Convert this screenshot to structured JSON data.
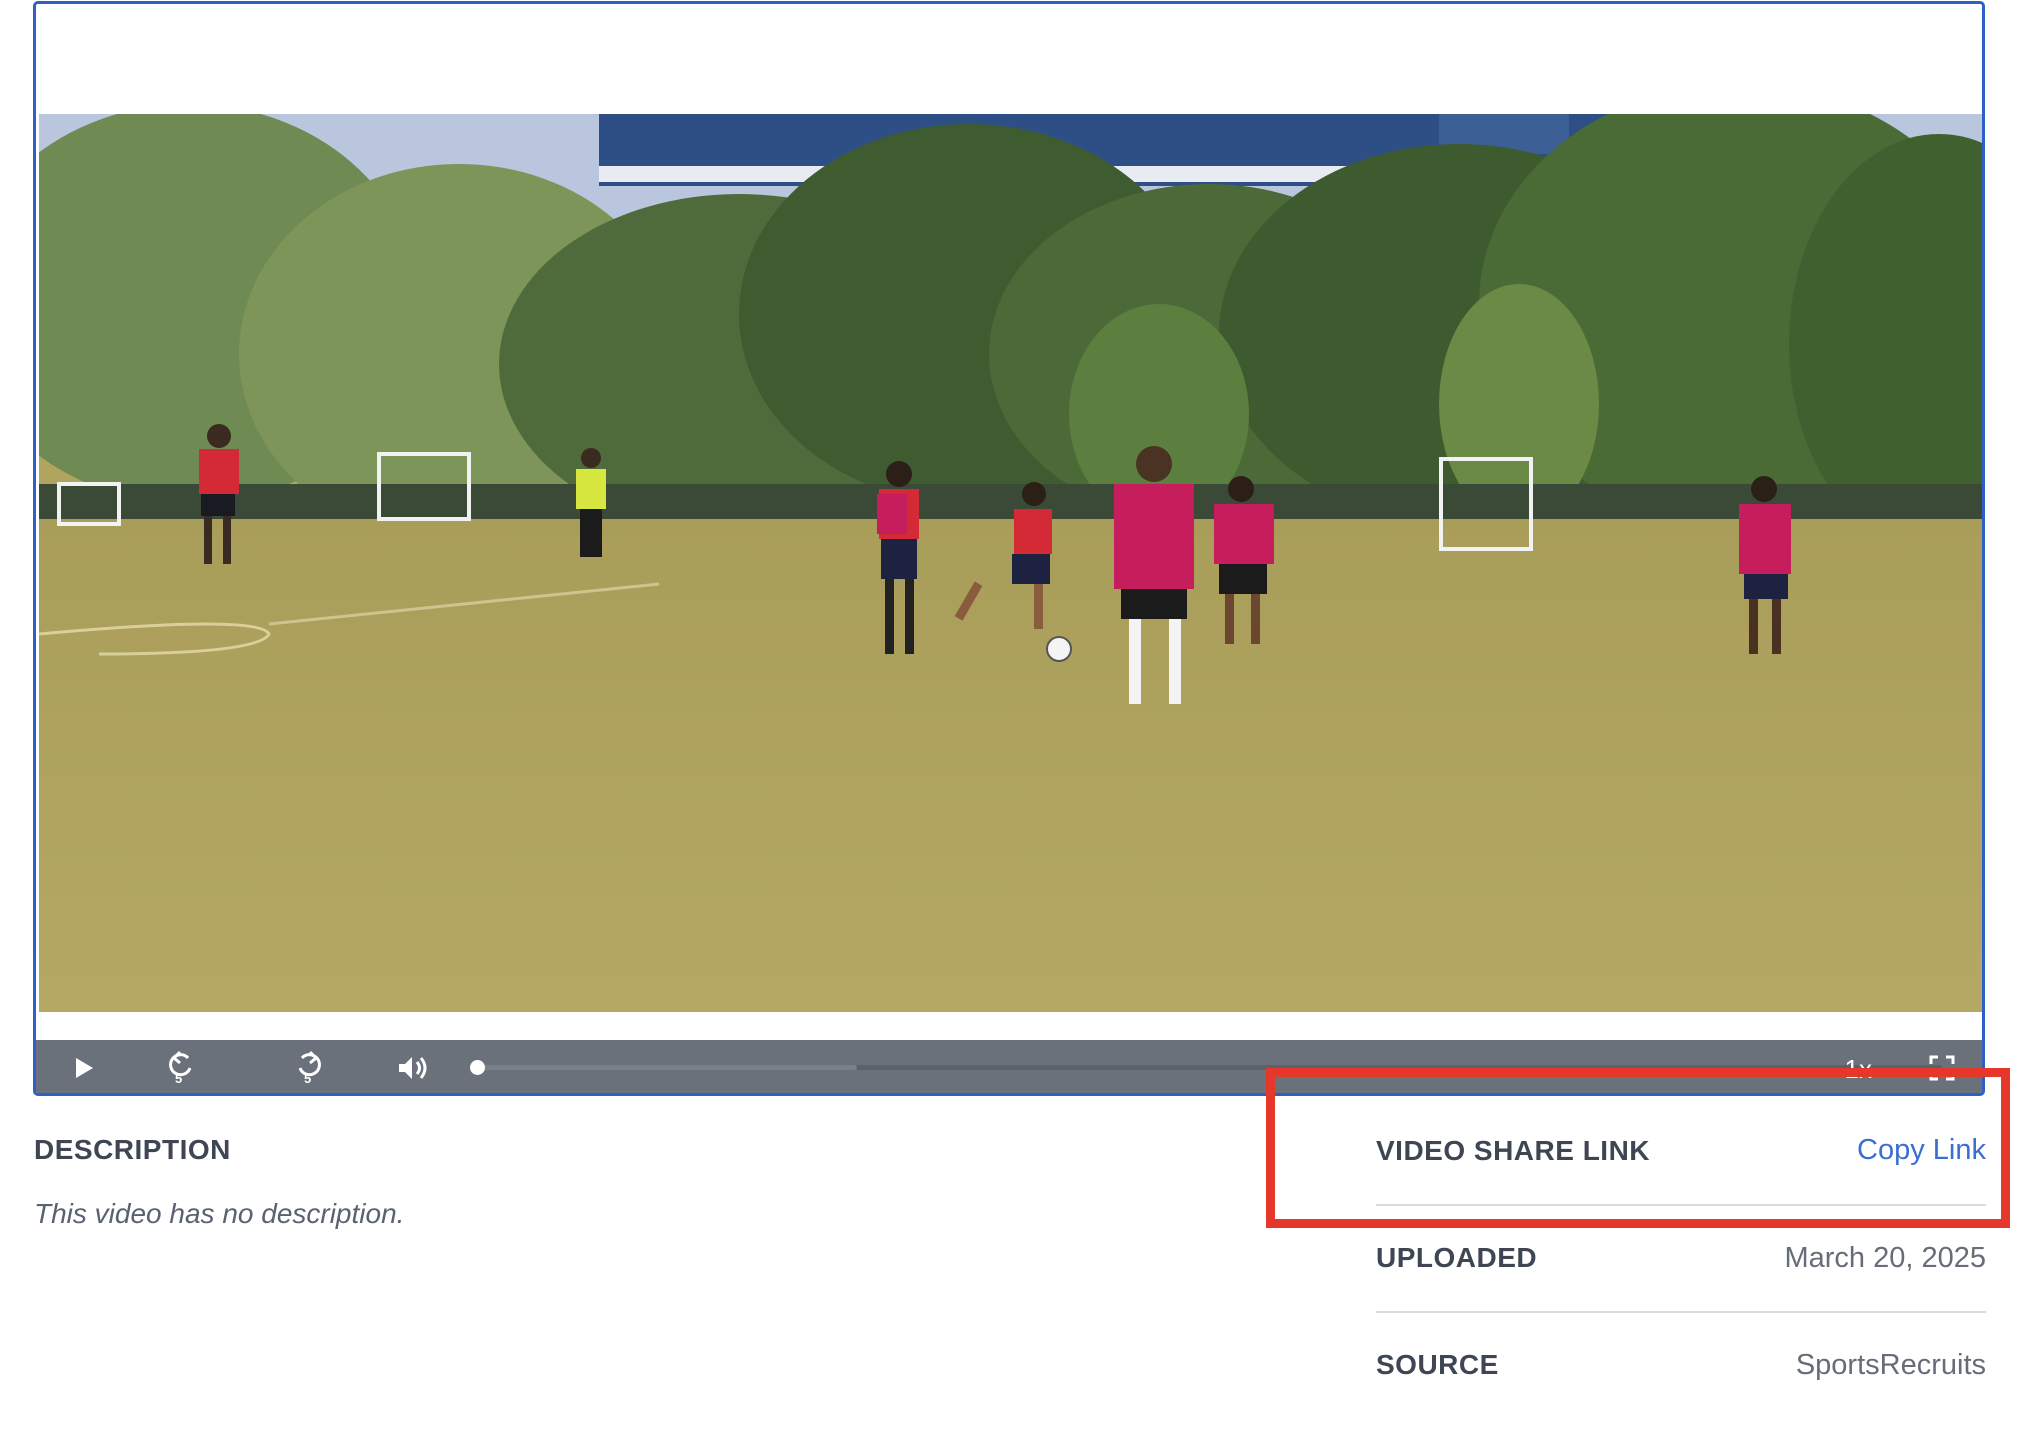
{
  "player": {
    "controls": {
      "play_icon": "play-icon",
      "rewind_icon": "rewind-5-icon",
      "forward_icon": "forward-5-icon",
      "volume_icon": "volume-icon",
      "fullscreen_icon": "fullscreen-icon",
      "speed": "1x",
      "progress": 0
    }
  },
  "description": {
    "heading": "DESCRIPTION",
    "text": "This video has no description."
  },
  "meta": {
    "share": {
      "label": "VIDEO SHARE LINK",
      "action": "Copy Link"
    },
    "uploaded": {
      "label": "UPLOADED",
      "value": "March 20, 2025"
    },
    "source": {
      "label": "SOURCE",
      "value": "SportsRecruits"
    }
  },
  "colors": {
    "player_border": "#2f5fc4",
    "controls_bar": "#6b717a",
    "link": "#3a6fd1",
    "highlight": "#e5372a"
  }
}
